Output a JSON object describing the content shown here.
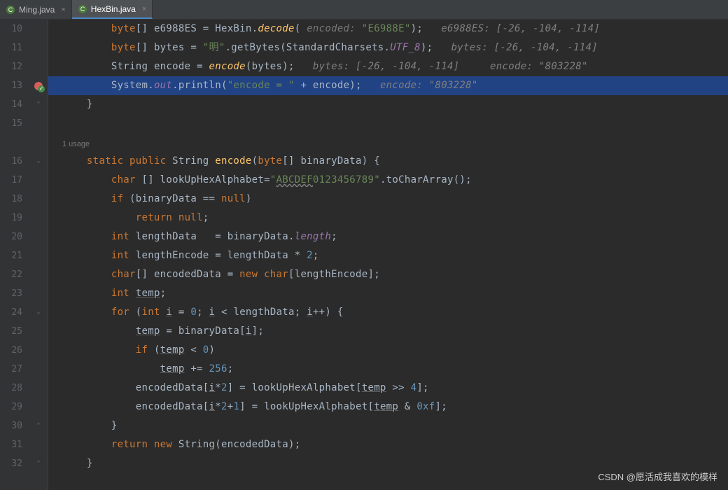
{
  "tabs": [
    {
      "label": "Ming.java",
      "active": false
    },
    {
      "label": "HexBin.java",
      "active": true
    }
  ],
  "usage_hint": "1 usage",
  "watermark": "CSDN @愿活成我喜欢的模样",
  "lines": {
    "l10": {
      "num": "10",
      "pre": "        ",
      "t1": "byte",
      "t2": "[] e6988ES = HexBin.",
      "t3": "decode",
      "t4": "( ",
      "t5": "encoded: ",
      "t6": "\"E6988E\"",
      "t7": ");   ",
      "t8": "e6988ES: [-26, -104, -114]"
    },
    "l11": {
      "num": "11",
      "pre": "        ",
      "t1": "byte",
      "t2": "[] bytes = ",
      "t3": "\"明\"",
      "t4": ".getBytes(StandardCharsets.",
      "t5": "UTF_8",
      "t6": ");   ",
      "t7": "bytes: [-26, -104, -114]"
    },
    "l12": {
      "num": "12",
      "pre": "        ",
      "t1": "String encode = ",
      "t2": "encode",
      "t3": "(bytes);   ",
      "t4": "bytes: [-26, -104, -114]     encode: \"803228\""
    },
    "l13": {
      "num": "13",
      "pre": "        ",
      "t1": "System.",
      "t2": "out",
      "t3": ".println(",
      "t4": "\"encode = \"",
      "t5": " + encode);   ",
      "t6": "encode: \"803228\""
    },
    "l14": {
      "num": "14",
      "pre": "    ",
      "t1": "}"
    },
    "l15": {
      "num": "15"
    },
    "l16": {
      "num": "16",
      "pre": "    ",
      "t1": "static public ",
      "t2": "String ",
      "t3": "encode",
      "t4": "(",
      "t5": "byte",
      "t6": "[] binaryData) {"
    },
    "l17": {
      "num": "17",
      "pre": "        ",
      "t1": "char ",
      "t2": "[] lookUpHexAlphabet=",
      "t3": "\"",
      "t4": "ABCDEF",
      "t5": "0123456789\"",
      "t6": ".toCharArray();"
    },
    "l18": {
      "num": "18",
      "pre": "        ",
      "t1": "if ",
      "t2": "(binaryData == ",
      "t3": "null",
      "t4": ")"
    },
    "l19": {
      "num": "19",
      "pre": "            ",
      "t1": "return null",
      "t2": ";"
    },
    "l20": {
      "num": "20",
      "pre": "        ",
      "t1": "int ",
      "t2": "lengthData   = binaryData.",
      "t3": "length",
      "t4": ";"
    },
    "l21": {
      "num": "21",
      "pre": "        ",
      "t1": "int ",
      "t2": "lengthEncode = lengthData * ",
      "t3": "2",
      "t4": ";"
    },
    "l22": {
      "num": "22",
      "pre": "        ",
      "t1": "char",
      "t2": "[] encodedData = ",
      "t3": "new char",
      "t4": "[lengthEncode];"
    },
    "l23": {
      "num": "23",
      "pre": "        ",
      "t1": "int ",
      "t2": "temp",
      "t3": ";"
    },
    "l24": {
      "num": "24",
      "pre": "        ",
      "t1": "for ",
      "t2": "(",
      "t3": "int ",
      "t4": "i",
      "t5": " = ",
      "t6": "0",
      "t7": "; ",
      "t8": "i",
      "t9": " < lengthData; ",
      "t10": "i",
      "t11": "++) {"
    },
    "l25": {
      "num": "25",
      "pre": "            ",
      "t1": "temp",
      "t2": " = binaryData[",
      "t3": "i",
      "t4": "];"
    },
    "l26": {
      "num": "26",
      "pre": "            ",
      "t1": "if ",
      "t2": "(",
      "t3": "temp",
      "t4": " < ",
      "t5": "0",
      "t6": ")"
    },
    "l27": {
      "num": "27",
      "pre": "                ",
      "t1": "temp",
      "t2": " += ",
      "t3": "256",
      "t4": ";"
    },
    "l28": {
      "num": "28",
      "pre": "            ",
      "t1": "encodedData[",
      "t2": "i",
      "t3": "*",
      "t4": "2",
      "t5": "] = lookUpHexAlphabet[",
      "t6": "temp",
      "t7": " >> ",
      "t8": "4",
      "t9": "];"
    },
    "l29": {
      "num": "29",
      "pre": "            ",
      "t1": "encodedData[",
      "t2": "i",
      "t3": "*",
      "t4": "2",
      "t5": "+",
      "t6": "1",
      "t7": "] = lookUpHexAlphabet[",
      "t8": "temp",
      "t9": " & ",
      "t10": "0xf",
      "t11": "];"
    },
    "l30": {
      "num": "30",
      "pre": "        ",
      "t1": "}"
    },
    "l31": {
      "num": "31",
      "pre": "        ",
      "t1": "return new ",
      "t2": "String(encodedData);"
    },
    "l32": {
      "num": "32",
      "pre": "    ",
      "t1": "}"
    }
  }
}
